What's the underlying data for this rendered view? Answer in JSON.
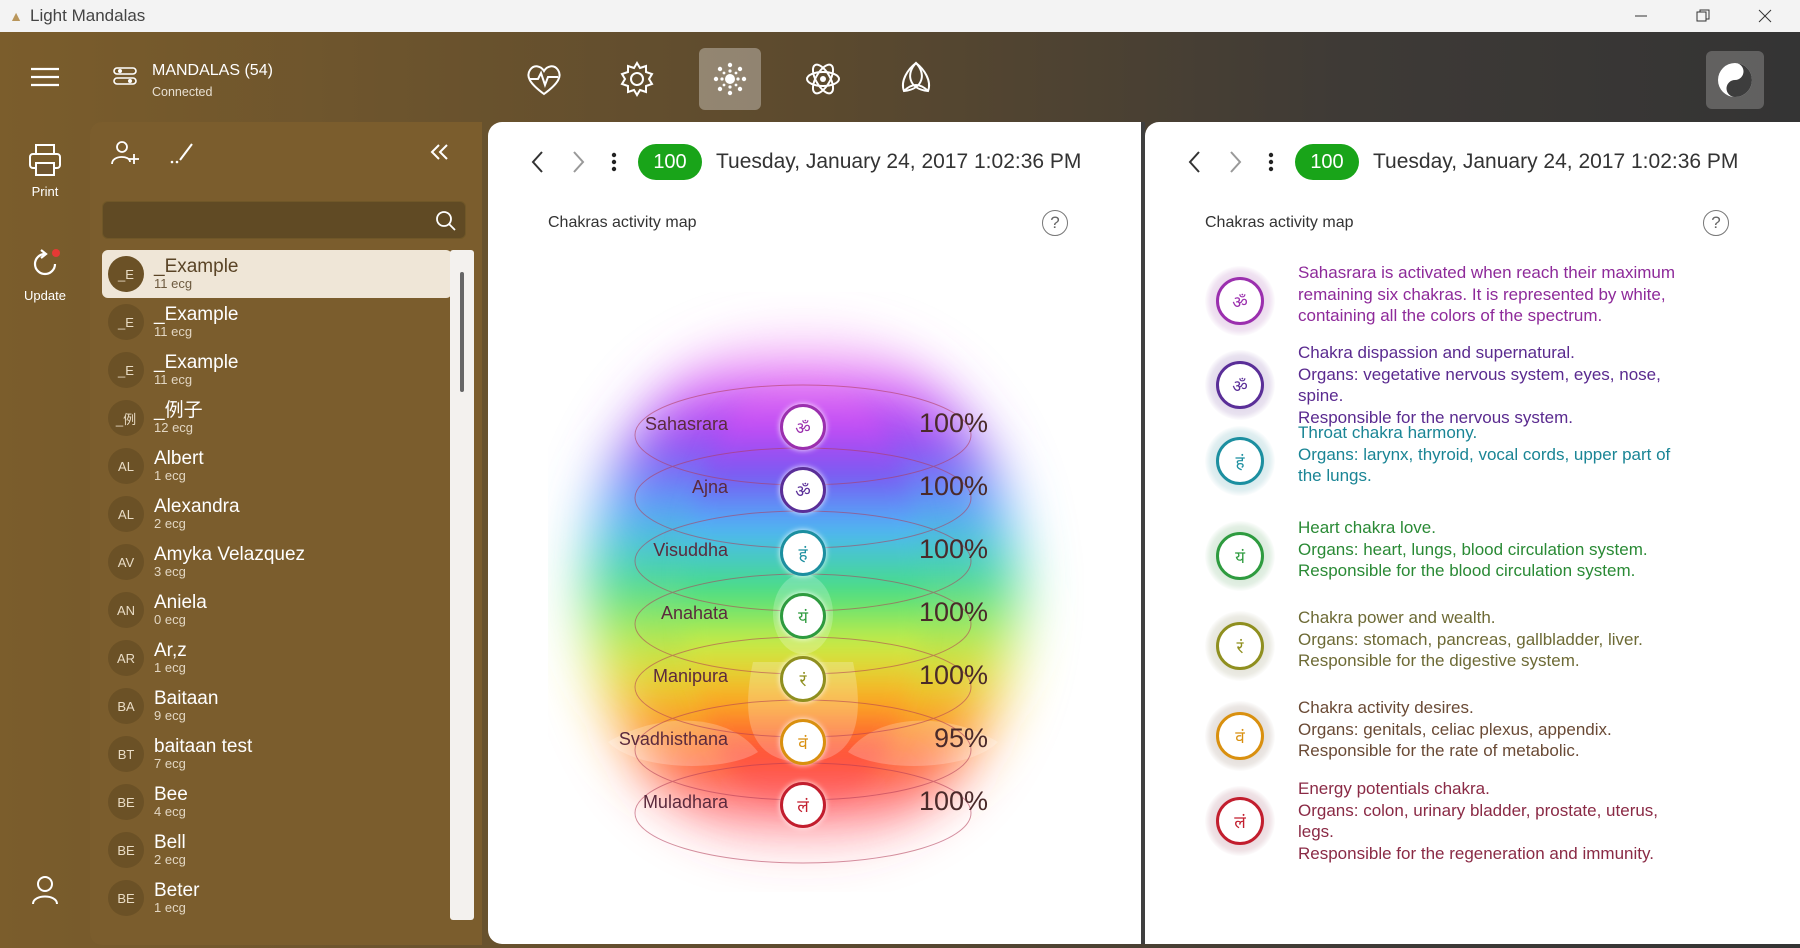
{
  "window": {
    "title": "Light Mandalas",
    "minimize": "—",
    "maximize": "❐",
    "close": "✕"
  },
  "rail": {
    "print_label": "Print",
    "update_label": "Update"
  },
  "header": {
    "group_title": "MANDALAS (54)",
    "group_status": "Connected"
  },
  "toolbar": {
    "active_tab": "chakra-mandala"
  },
  "search": {
    "value": "",
    "placeholder": ""
  },
  "people": [
    {
      "initials": "_E",
      "name": "_Example",
      "count": "11 ecg",
      "selected": true
    },
    {
      "initials": "_E",
      "name": "_Example",
      "count": "11 ecg"
    },
    {
      "initials": "_E",
      "name": "_Example",
      "count": "11 ecg"
    },
    {
      "initials": "_例",
      "name": "_例子",
      "count": "12 ecg"
    },
    {
      "initials": "AL",
      "name": "Albert",
      "count": "1 ecg"
    },
    {
      "initials": "AL",
      "name": "Alexandra",
      "count": "2 ecg"
    },
    {
      "initials": "AV",
      "name": "Amyka Velazquez",
      "count": "3 ecg"
    },
    {
      "initials": "AN",
      "name": "Aniela",
      "count": "0 ecg"
    },
    {
      "initials": "AR",
      "name": "Ar,z",
      "count": "1 ecg"
    },
    {
      "initials": "BA",
      "name": "Baitaan",
      "count": "9 ecg"
    },
    {
      "initials": "BT",
      "name": "baitaan test",
      "count": "7 ecg"
    },
    {
      "initials": "BE",
      "name": "Bee",
      "count": "4 ecg"
    },
    {
      "initials": "BE",
      "name": "Bell",
      "count": "2 ecg"
    },
    {
      "initials": "BE",
      "name": "Beter",
      "count": "1 ecg"
    }
  ],
  "left_panel": {
    "score": "100",
    "datetime": "Tuesday, January 24, 2017 1:02:36 PM",
    "title": "Chakras activity map",
    "help": "?"
  },
  "right_panel": {
    "score": "100",
    "datetime": "Tuesday, January 24, 2017 1:02:36 PM",
    "title": "Chakras activity map",
    "help": "?"
  },
  "chakras": [
    {
      "name": "Sahasrara",
      "value": "100%",
      "percent": 100,
      "color": "#9b2fae",
      "glyph": "ॐ"
    },
    {
      "name": "Ajna",
      "value": "100%",
      "percent": 100,
      "color": "#5a2e98",
      "glyph": "ॐ"
    },
    {
      "name": "Visuddha",
      "value": "100%",
      "percent": 100,
      "color": "#1c8fa0",
      "glyph": "हं"
    },
    {
      "name": "Anahata",
      "value": "100%",
      "percent": 100,
      "color": "#2e9b3f",
      "glyph": "यं"
    },
    {
      "name": "Manipura",
      "value": "100%",
      "percent": 100,
      "color": "#8f8f1f",
      "glyph": "रं"
    },
    {
      "name": "Svadhisthana",
      "value": "95%",
      "percent": 95,
      "color": "#d9900f",
      "glyph": "वं"
    },
    {
      "name": "Muladhara",
      "value": "100%",
      "percent": 100,
      "color": "#c21e2e",
      "glyph": "लं"
    }
  ],
  "descriptions": [
    {
      "color": "#8e2a9a",
      "lines": [
        "Sahasrara is activated when reach their maximum",
        "remaining six chakras. It is represented by white,",
        "containing all the colors of the spectrum."
      ]
    },
    {
      "color": "#5a2a8f",
      "lines": [
        "Chakra dispassion and supernatural.",
        "Organs: vegetative nervous system, eyes, nose,",
        "spine.",
        "Responsible for the nervous system."
      ]
    },
    {
      "color": "#1a8595",
      "lines": [
        "Throat chakra harmony.",
        "Organs: larynx, thyroid, vocal cords, upper part of",
        "the lungs."
      ]
    },
    {
      "color": "#2a8a35",
      "lines": [
        "Heart chakra love.",
        "Organs: heart, lungs, blood circulation system.",
        "Responsible for the blood circulation system."
      ]
    },
    {
      "color": "#6d6a35",
      "lines": [
        "Chakra power and wealth.",
        "Organs: stomach, pancreas, gallbladder, liver.",
        "Responsible for the digestive system."
      ]
    },
    {
      "color": "#6a4a35",
      "lines": [
        "Chakra activity desires.",
        "Organs: genitals, celiac plexus, appendix.",
        "Responsible for the rate of metabolic."
      ]
    },
    {
      "color": "#8a2a45",
      "lines": [
        "Energy potentials chakra.",
        "Organs: colon, urinary bladder, prostate, uterus,",
        "legs.",
        "Responsible for the regeneration and immunity."
      ]
    }
  ]
}
